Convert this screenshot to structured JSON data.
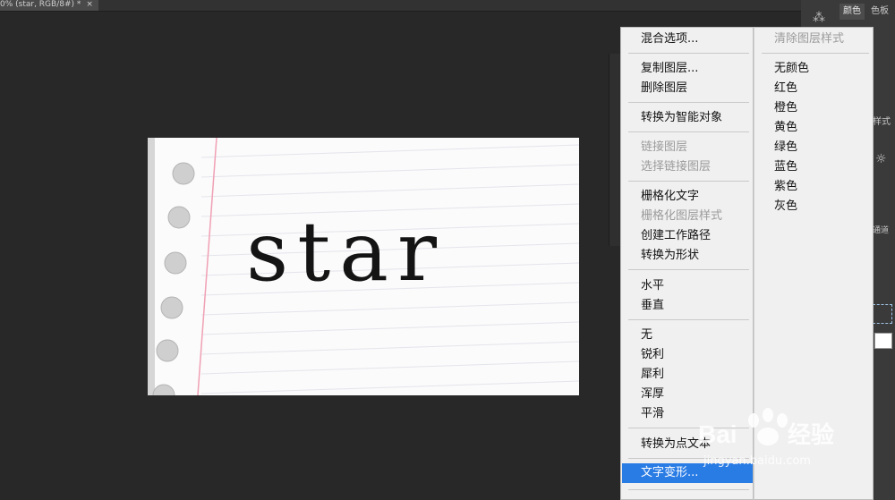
{
  "document_tab": {
    "title": "0% (star, RGB/8#) *",
    "close": "×"
  },
  "canvas": {
    "text": "star"
  },
  "panels": {
    "color_tab": "颜色",
    "swatches_tab": "色板",
    "styles_label": "样式",
    "channels_label": "通道"
  },
  "context_menu": {
    "items": [
      {
        "label": "混合选项...",
        "enabled": true
      },
      {
        "label": "复制图层...",
        "enabled": true
      },
      {
        "label": "删除图层",
        "enabled": true
      },
      {
        "label": "转换为智能对象",
        "enabled": true
      },
      {
        "label": "链接图层",
        "enabled": false
      },
      {
        "label": "选择链接图层",
        "enabled": false
      },
      {
        "label": "栅格化文字",
        "enabled": true
      },
      {
        "label": "栅格化图层样式",
        "enabled": false
      },
      {
        "label": "创建工作路径",
        "enabled": true
      },
      {
        "label": "转换为形状",
        "enabled": true
      },
      {
        "label": "水平",
        "enabled": true
      },
      {
        "label": "垂直",
        "enabled": true
      },
      {
        "label": "无",
        "enabled": true
      },
      {
        "label": "锐利",
        "enabled": true
      },
      {
        "label": "犀利",
        "enabled": true
      },
      {
        "label": "浑厚",
        "enabled": true
      },
      {
        "label": "平滑",
        "enabled": true
      },
      {
        "label": "转换为点文本",
        "enabled": true
      },
      {
        "label": "文字变形...",
        "enabled": true,
        "highlighted": true
      }
    ],
    "right_items": [
      {
        "label": "清除图层样式",
        "enabled": false
      },
      {
        "label": "无颜色",
        "enabled": true
      },
      {
        "label": "红色",
        "enabled": true
      },
      {
        "label": "橙色",
        "enabled": true
      },
      {
        "label": "黄色",
        "enabled": true
      },
      {
        "label": "绿色",
        "enabled": true
      },
      {
        "label": "蓝色",
        "enabled": true
      },
      {
        "label": "紫色",
        "enabled": true
      },
      {
        "label": "灰色",
        "enabled": true
      }
    ]
  },
  "watermark": {
    "brand": "Bai",
    "brand2": "经验",
    "url": "jingyan.baidu.com"
  },
  "colors": {
    "highlight": "#2a7ce5",
    "menu_bg": "#f0f0f0",
    "workspace": "#282828"
  }
}
